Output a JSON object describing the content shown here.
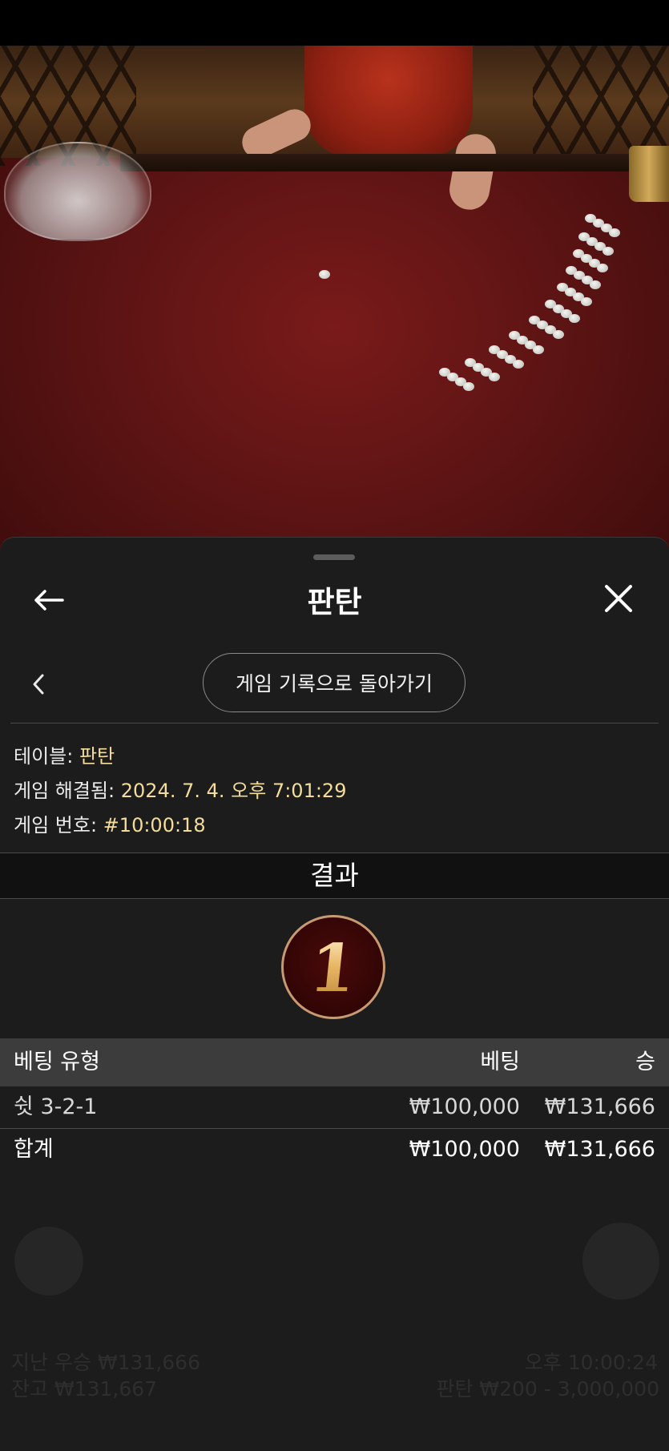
{
  "sheet": {
    "title": "판탄",
    "history_button_label": "게임 기록으로 돌아가기"
  },
  "details": {
    "table_label": "테이블:",
    "table_value": "판탄",
    "resolved_label": "게임 해결됨:",
    "resolved_value": "2024. 7. 4. 오후 7:01:29",
    "game_no_label": "게임 번호:",
    "game_no_value": "#10:00:18"
  },
  "result": {
    "heading": "결과",
    "number": "1"
  },
  "bets_table": {
    "headers": [
      "베팅 유형",
      "베팅",
      "승"
    ],
    "rows": [
      {
        "type": "쉿 3-2-1",
        "bet": "₩100,000",
        "win": "₩131,666"
      }
    ],
    "total": {
      "label": "합계",
      "bet": "₩100,000",
      "win": "₩131,666"
    }
  },
  "background_ui": {
    "last_win": "지난 우승 ₩131,666",
    "balance": "잔고 ₩131,667",
    "bet_limit": "판탄 ₩200 - 3,000,000",
    "time": "오후 10:00:24"
  },
  "colors": {
    "sheet_bg": "#1c1c1c",
    "value_text": "#f4dd9a",
    "header_row_bg": "#3c3c3c",
    "badge_border": "#c79a72",
    "badge_bg": "#2e0404"
  },
  "icons": [
    "back-arrow-icon",
    "close-icon",
    "chevron-left-icon",
    "menu-icon",
    "grid-icon"
  ]
}
